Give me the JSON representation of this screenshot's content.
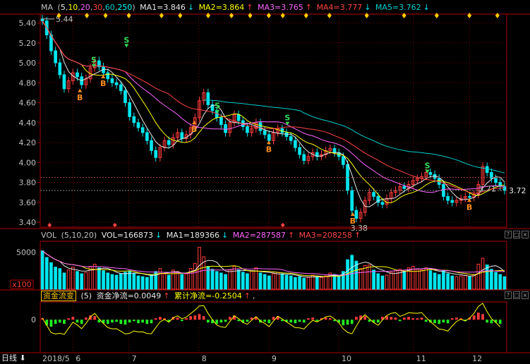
{
  "colors": {
    "up": "#ff3c3c",
    "down": "#00e5ee",
    "ma5": "#e8e8e8",
    "ma10": "#ffff00",
    "ma20": "#ff66ff",
    "ma30": "#ff4444",
    "ma60": "#00cccc",
    "ma250": "#00ffff",
    "grid": "#7a0000",
    "axis": "#b00000",
    "text": "#c0c0c0",
    "buy": "#ff8c1a",
    "sell": "#33dd55"
  },
  "main_header": {
    "name": "MA",
    "params": [
      "5",
      "10",
      "20",
      "30",
      "60",
      "250"
    ],
    "ma1": "MA1=3.846",
    "ma2": "MA2=3.864",
    "ma3": "MA3=3.765",
    "ma4": "MA4=3.777",
    "ma5": "MA5=3.762"
  },
  "vol_header": {
    "name": "VOL",
    "params": "(5,10,20)",
    "vol": "VOL=166873",
    "ma1": "MA1=189366",
    "ma2": "MA2=287587",
    "ma3": "MA3=208258"
  },
  "flow_header": {
    "name": "资金流变",
    "param": "(5)",
    "net": "资金净流=0.0049",
    "cum": "累计净流=-0.2504"
  },
  "bottom_bar": {
    "period": "日线"
  },
  "chart_data": [
    {
      "type": "candlestick",
      "panel": "price",
      "y_ticks": [
        "5.40",
        "5.20",
        "5.00",
        "4.80",
        "4.60",
        "4.40",
        "4.20",
        "4.00",
        "3.80",
        "3.60",
        "3.40"
      ],
      "ylim": [
        3.38,
        5.46
      ],
      "x_ticks": [
        "2018/5",
        "6",
        "7",
        "8",
        "9",
        "10",
        "11",
        "12"
      ],
      "annotations": {
        "high": "5.44",
        "low": "3.38",
        "current": "3.72",
        "last_close": "3.71"
      },
      "signals": [
        {
          "x": 0.085,
          "label": "B",
          "y": 4.74
        },
        {
          "x": 0.115,
          "label": "S",
          "y": 4.96
        },
        {
          "x": 0.135,
          "label": "B",
          "y": 4.88
        },
        {
          "x": 0.185,
          "label": "S",
          "y": 5.16
        },
        {
          "x": 0.33,
          "label": "B",
          "y": 4.42
        },
        {
          "x": 0.38,
          "label": "S",
          "y": 4.5
        },
        {
          "x": 0.49,
          "label": "B",
          "y": 4.22
        },
        {
          "x": 0.53,
          "label": "S",
          "y": 4.38
        },
        {
          "x": 0.67,
          "label": "B",
          "y": 3.5
        },
        {
          "x": 0.83,
          "label": "S",
          "y": 3.9
        },
        {
          "x": 0.92,
          "label": "B",
          "y": 3.64
        }
      ],
      "close": [
        5.42,
        5.28,
        5.12,
        5.0,
        4.88,
        4.74,
        4.82,
        4.9,
        4.86,
        4.78,
        4.84,
        4.95,
        5.02,
        4.96,
        4.9,
        4.84,
        4.8,
        4.78,
        4.72,
        4.6,
        4.46,
        4.4,
        4.35,
        4.3,
        4.22,
        4.12,
        4.05,
        4.15,
        4.22,
        4.18,
        4.25,
        4.3,
        4.24,
        4.28,
        4.35,
        4.45,
        4.62,
        4.7,
        4.58,
        4.52,
        4.45,
        4.38,
        4.3,
        4.4,
        4.48,
        4.42,
        4.36,
        4.3,
        4.34,
        4.4,
        4.32,
        4.28,
        4.22,
        4.3,
        4.34,
        4.3,
        4.26,
        4.22,
        4.15,
        4.08,
        4.02,
        4.06,
        4.1,
        4.06,
        4.08,
        4.12,
        4.14,
        4.1,
        4.06,
        3.98,
        3.72,
        3.52,
        3.44,
        3.5,
        3.62,
        3.7,
        3.66,
        3.6,
        3.58,
        3.64,
        3.7,
        3.72,
        3.76,
        3.74,
        3.78,
        3.82,
        3.84,
        3.86,
        3.9,
        3.88,
        3.84,
        3.78,
        3.66,
        3.62,
        3.6,
        3.62,
        3.64,
        3.66,
        3.65,
        3.68,
        3.78,
        3.96,
        3.9,
        3.84,
        3.8,
        3.76,
        3.72
      ],
      "ma_levels": {
        "ma5": 3.846,
        "ma10": 3.864,
        "ma20": 3.765,
        "ma30": 3.777,
        "ma60": 3.762
      }
    },
    {
      "type": "bar",
      "panel": "volume",
      "y_ticks": [
        "5000"
      ],
      "unit": "x100",
      "values": [
        5200,
        4300,
        3600,
        3000,
        2800,
        2200,
        2600,
        3000,
        2400,
        2100,
        2300,
        3100,
        3400,
        2900,
        2500,
        2200,
        2000,
        1900,
        2100,
        2300,
        2500,
        2200,
        1800,
        1700,
        1600,
        2000,
        2400,
        2800,
        2100,
        1900,
        2600,
        2400,
        2000,
        2100,
        2800,
        3500,
        5700,
        4400,
        3100,
        2700,
        2400,
        2200,
        2000,
        2600,
        3100,
        2600,
        2300,
        2100,
        2500,
        2900,
        2200,
        2000,
        1800,
        2100,
        2300,
        2100,
        1900,
        1800,
        1600,
        1700,
        1500,
        1600,
        1900,
        1700,
        1600,
        1800,
        2200,
        2000,
        1800,
        2400,
        4000,
        4600,
        3800,
        2800,
        3200,
        3300,
        2600,
        2100,
        1800,
        1900,
        2300,
        2500,
        2700,
        2400,
        2900,
        3100,
        2700,
        2600,
        2900,
        2500,
        2200,
        2000,
        2500,
        2100,
        1800,
        1700,
        1800,
        1900,
        1700,
        2000,
        3400,
        4200,
        3300,
        2700,
        2300,
        2000,
        1700
      ]
    },
    {
      "type": "bar",
      "panel": "money_flow",
      "y_ticks": [
        "0"
      ],
      "values": [
        0.1,
        -0.4,
        -0.5,
        -0.3,
        -0.2,
        -0.3,
        0.1,
        0.2,
        -0.2,
        -0.3,
        0.15,
        0.3,
        0.25,
        -0.2,
        -0.25,
        -0.3,
        -0.2,
        -0.15,
        -0.3,
        -0.35,
        -0.2,
        -0.1,
        -0.25,
        -0.2,
        -0.3,
        -0.25,
        0.1,
        0.2,
        0.1,
        -0.15,
        0.2,
        0.15,
        -0.1,
        0.1,
        0.25,
        0.3,
        0.4,
        0.25,
        -0.2,
        -0.25,
        -0.3,
        -0.2,
        -0.15,
        0.2,
        0.3,
        -0.1,
        -0.2,
        -0.15,
        0.15,
        0.2,
        -0.2,
        -0.15,
        -0.25,
        0.2,
        0.25,
        -0.1,
        -0.15,
        -0.2,
        -0.25,
        -0.15,
        -0.2,
        0.1,
        0.15,
        -0.1,
        0.1,
        0.15,
        0.1,
        -0.1,
        -0.2,
        -0.4,
        -0.35,
        -0.3,
        0.2,
        0.3,
        0.25,
        -0.15,
        -0.2,
        -0.2,
        0.2,
        0.25,
        0.2,
        0.15,
        -0.1,
        0.15,
        0.2,
        0.1,
        0.1,
        0.15,
        -0.15,
        -0.2,
        -0.25,
        -0.3,
        -0.2,
        -0.25,
        0.1,
        0.15,
        0.1,
        -0.1,
        0.15,
        0.3,
        0.5,
        0.4,
        -0.2,
        -0.25,
        -0.2,
        -0.3
      ]
    }
  ]
}
